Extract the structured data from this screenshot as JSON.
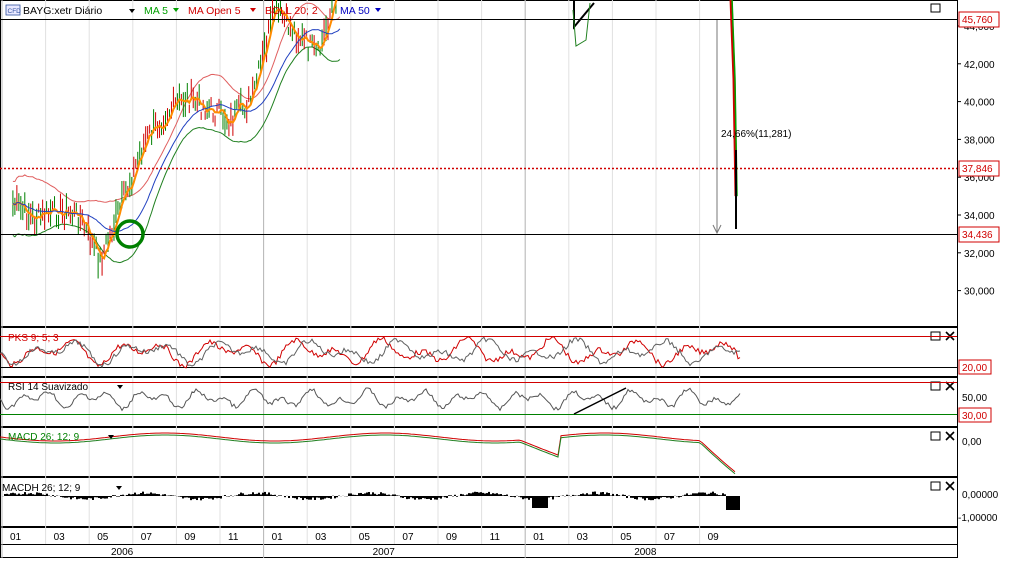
{
  "main_legend": {
    "symbol_badge": "CFD",
    "symbol": "BAYG:xetr Diário",
    "items": [
      {
        "label": "MA 5",
        "color": "#00a000"
      },
      {
        "label": "MA Open  5",
        "color": "#d00000"
      },
      {
        "label": "BOLL 20; 2",
        "color": "#d00000"
      },
      {
        "label": "MA 50",
        "color": "#0000c0"
      }
    ],
    "annotation": "24,66%(11,281)"
  },
  "price_levels": {
    "top": "45,760",
    "mid": "37,846",
    "low": "34,436"
  },
  "sub_panels": {
    "stoch": {
      "label": "PKS 9; 5; 3",
      "level": "20,00"
    },
    "rsi": {
      "label": "RSI 14 Suavizado",
      "levels": [
        "50,00",
        "30,00"
      ]
    },
    "macd": {
      "label": "MACD 26; 12; 9",
      "level": "0,00"
    },
    "macdh": {
      "label": "MACDH 26; 12; 9",
      "levels": [
        "0,00000",
        "-1,00000"
      ]
    }
  },
  "chart_data": {
    "type": "line",
    "title": "BAYG:xetr Diário",
    "xlabel": "",
    "ylabel": "",
    "x_months": [
      "01",
      "03",
      "05",
      "07",
      "09",
      "11",
      "01",
      "03",
      "05",
      "07",
      "09",
      "11",
      "01",
      "03",
      "05",
      "07",
      "09"
    ],
    "x_years": [
      "2006",
      "2007",
      "2008"
    ],
    "y_ticks": [
      "44,000",
      "42,000",
      "40,000",
      "38,000",
      "36,000",
      "34,000",
      "32,000",
      "30,000"
    ],
    "ylim": [
      29.5,
      47.0
    ],
    "price_close": [
      {
        "x": "2006-01",
        "y": 34.6
      },
      {
        "x": "2006-02",
        "y": 33.8
      },
      {
        "x": "2006-03",
        "y": 34.2
      },
      {
        "x": "2006-04",
        "y": 34.0
      },
      {
        "x": "2006-05",
        "y": 31.6
      },
      {
        "x": "2006-06",
        "y": 34.6
      },
      {
        "x": "2006-07",
        "y": 37.8
      },
      {
        "x": "2006-08",
        "y": 39.4
      },
      {
        "x": "2006-09",
        "y": 40.2
      },
      {
        "x": "2006-10",
        "y": 39.6
      },
      {
        "x": "2006-11",
        "y": 39.0
      },
      {
        "x": "2006-12",
        "y": 40.2
      },
      {
        "x": "2007-01",
        "y": 44.8
      },
      {
        "x": "2007-02",
        "y": 43.6
      },
      {
        "x": "2007-03",
        "y": 42.4
      },
      {
        "x": "2007-04",
        "y": 46.6
      }
    ],
    "price_late": [
      {
        "x": "2008-09",
        "y": 47.0
      },
      {
        "x": "2008-09",
        "y": 44.0
      },
      {
        "x": "2008-10",
        "y": 41.2
      },
      {
        "x": "2008-10",
        "y": 35.0
      }
    ],
    "levels": [
      45.76,
      37.846,
      34.436
    ],
    "grid": true,
    "legend_position": "top-left"
  }
}
